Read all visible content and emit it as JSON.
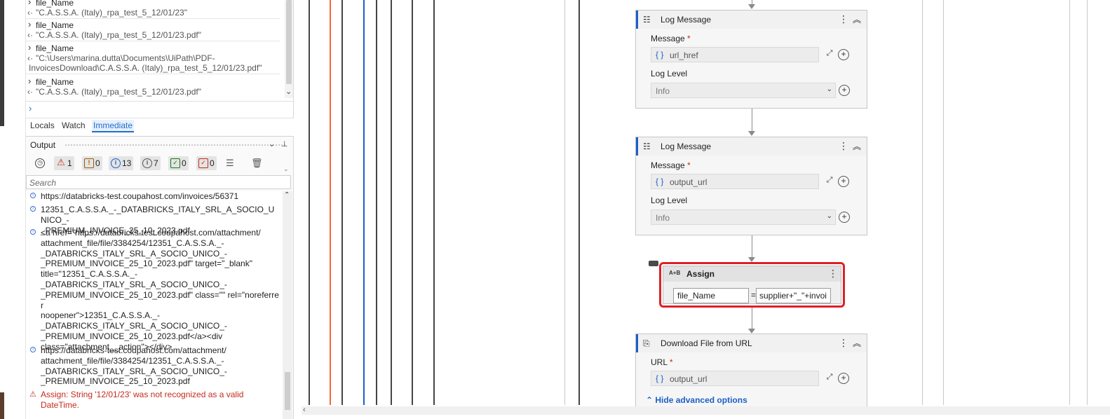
{
  "immediate": {
    "entries": [
      {
        "name": "file_Name",
        "value": "\"C.A.S.S.A. (Italy)_rpa_test_5_12/01/23\""
      },
      {
        "name": "file_Name",
        "value": "\"C.A.S.S.A. (Italy)_rpa_test_5_12/01/23.pdf\""
      },
      {
        "name": "file_Name",
        "value_line1": "\"C:\\Users\\marina.dutta\\Documents\\UiPath\\PDF-",
        "value_line2": "InvoicesDownload\\C.A.S.S.A. (Italy)_rpa_test_5_12/01/23.pdf\""
      },
      {
        "name": "file_Name",
        "value": "\"C.A.S.S.A. (Italy)_rpa_test_5_12/01/23.pdf\""
      }
    ],
    "prompt": "›"
  },
  "tabs": [
    {
      "label": "Locals"
    },
    {
      "label": "Watch"
    },
    {
      "label": "Immediate"
    }
  ],
  "output": {
    "title": "Output",
    "filters": {
      "errors": "1",
      "warnings": "0",
      "info": "13",
      "trace": "7",
      "success": "0",
      "verbose": "0"
    },
    "search_placeholder": "Search",
    "items": [
      {
        "type": "info",
        "text": "https://databricks-test.coupahost.com/invoices/56371"
      },
      {
        "type": "info",
        "lines": [
          "12351_C.A.S.S.A._-_DATABRICKS_ITALY_SRL_A_SOCIO_UNICO_-",
          "_PREMIUM_INVOICE_25_10_2023.pdf"
        ]
      },
      {
        "type": "info",
        "lines": [
          "<a href=\"https://databricks-test.coupahost.com/attachment/",
          "attachment_file/file/3384254/12351_C.A.S.S.A._-",
          "_DATABRICKS_ITALY_SRL_A_SOCIO_UNICO_-",
          "_PREMIUM_INVOICE_25_10_2023.pdf\" target=\"_blank\"",
          "title=\"12351_C.A.S.S.A._-",
          "_DATABRICKS_ITALY_SRL_A_SOCIO_UNICO_-",
          "_PREMIUM_INVOICE_25_10_2023.pdf\" class=\"\" rel=\"noreferrer",
          "noopener\">12351_C.A.S.S.A._-",
          "_DATABRICKS_ITALY_SRL_A_SOCIO_UNICO_-",
          "_PREMIUM_INVOICE_25_10_2023.pdf</a><div",
          "class=\"attachment__action\"></div>"
        ]
      },
      {
        "type": "info",
        "lines": [
          "https://databricks-test.coupahost.com/attachment/",
          "attachment_file/file/3384254/12351_C.A.S.S.A._-",
          "_DATABRICKS_ITALY_SRL_A_SOCIO_UNICO_-",
          "_PREMIUM_INVOICE_25_10_2023.pdf"
        ]
      },
      {
        "type": "error",
        "lines": [
          "Assign: String '12/01/23' was not recognized as a valid",
          "DateTime."
        ]
      }
    ]
  },
  "designer": {
    "log1": {
      "title": "Log Message",
      "message_label": "Message",
      "message_value": "url_href",
      "level_label": "Log Level",
      "level_value": "Info"
    },
    "log2": {
      "title": "Log Message",
      "message_label": "Message",
      "message_value": "output_url",
      "level_label": "Log Level",
      "level_value": "Info"
    },
    "assign": {
      "icon_text": "A+B",
      "title": "Assign",
      "to": "file_Name",
      "eq": "=",
      "value": "supplier+\"_\"+invoi"
    },
    "download": {
      "title": "Download File from URL",
      "url_label": "URL",
      "url_value": "output_url",
      "hide_advanced": "Hide advanced options"
    },
    "required_mark": "*",
    "brace": "{ }"
  }
}
